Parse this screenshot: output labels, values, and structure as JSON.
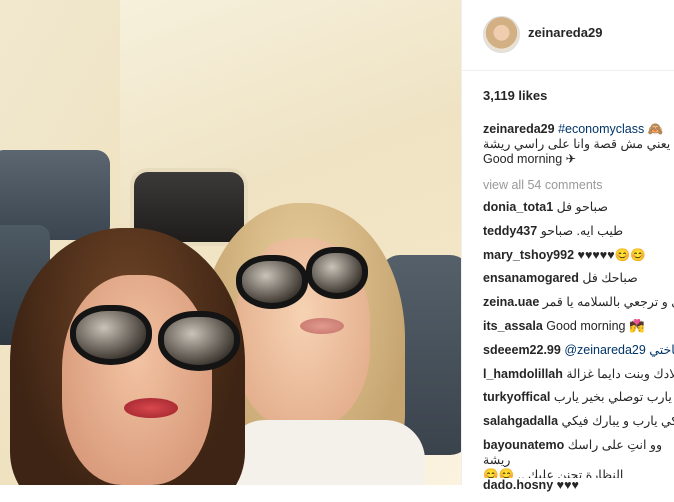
{
  "post": {
    "username": "zeinareda29",
    "likes": "3,119 likes",
    "caption_username": "zeinareda29",
    "caption_hashtag": "#economyclass",
    "caption_emoji": "🙈",
    "caption_arabic": "عادي يعني مش قصة وانا على راسي ريشة",
    "caption_line3": "Good morning ✈",
    "view_all": "view all 54 comments"
  },
  "comments": [
    {
      "user": "donia_tota1",
      "text": "صباحو فل"
    },
    {
      "user": "teddy437",
      "text": "طيب ايه. صباحو"
    },
    {
      "user": "mary_tshoy992",
      "text": "♥♥♥♥♥😊😊"
    },
    {
      "user": "ensanamogared",
      "text": "صباحك فل"
    },
    {
      "user": "zeina.uae",
      "text": "تروحي و ترجعي بالسلامه يا قمر"
    },
    {
      "user": "its_assala",
      "text": "Good morning 💏"
    },
    {
      "user": "sdeeem22.99",
      "text": "@zeinareda29 ياختي"
    },
    {
      "user": "l_hamdolillah",
      "text": "ولادك وبنت دايما غزالة"
    },
    {
      "user": "turkyoffical",
      "text": "دنا يارب توصلي بخير يارب"
    },
    {
      "user": "salahgadalla",
      "text": "وديكي يارب و يبارك فيكي"
    },
    {
      "user": "bayounatemo",
      "text": "وو انتِ على راسك ريشة",
      "text2": "النظارة تجنن عليكِ .. 😊😊"
    },
    {
      "user": "dado.hosny",
      "text": "♥♥♥"
    }
  ],
  "colors": {
    "text": "#262626",
    "muted": "#999999",
    "link": "#003569",
    "divider": "#efefef"
  },
  "icons": {
    "airplane": "airplane-icon",
    "monkey": "see-no-evil-monkey-icon"
  }
}
